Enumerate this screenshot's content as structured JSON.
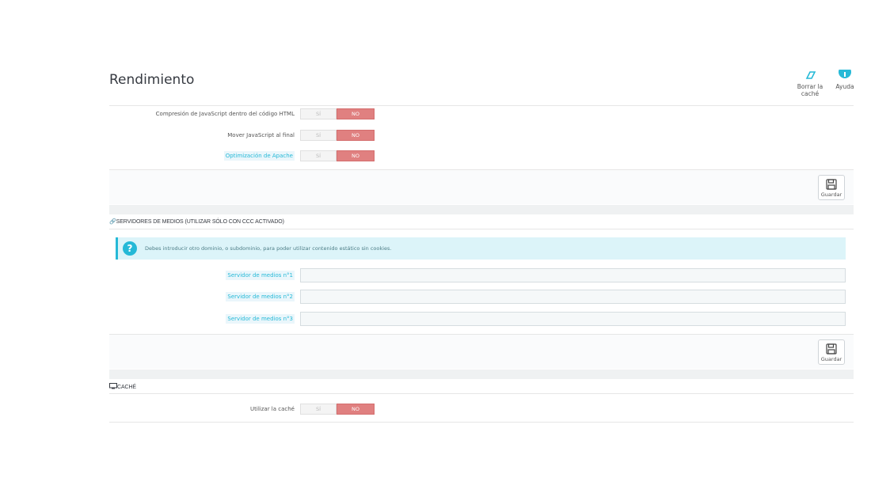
{
  "page": {
    "title": "Rendimiento"
  },
  "toolbar": {
    "clear_cache_label": "Borrar la caché",
    "help_label": "Ayuda"
  },
  "colors": {
    "accent": "#25b9d7",
    "no_active": "#e08080"
  },
  "options_js": [
    {
      "label": "Compresión de JavaScript dentro del código HTML",
      "yes": "SÍ",
      "no": "NO"
    },
    {
      "label": "Mover JavaScript al final",
      "yes": "SÍ",
      "no": "NO"
    },
    {
      "label": "Optimización de Apache",
      "yes": "SÍ",
      "no": "NO"
    }
  ],
  "save_label": "Guardar",
  "media_servers": {
    "heading": "SERVIDORES DE MEDIOS (UTILIZAR SÓLO CON CCC ACTIVADO)",
    "alert": "Debes introducir otro dominio, o subdominio, para poder utilizar contenido estático sin cookies.",
    "fields": [
      {
        "label": "Servidor de medios n°1",
        "value": ""
      },
      {
        "label": "Servidor de medios n°2",
        "value": ""
      },
      {
        "label": "Servidor de medios n°3",
        "value": ""
      }
    ]
  },
  "cache": {
    "heading": "CACHÉ",
    "label": "Utilizar la caché",
    "yes": "SÍ",
    "no": "NO"
  }
}
